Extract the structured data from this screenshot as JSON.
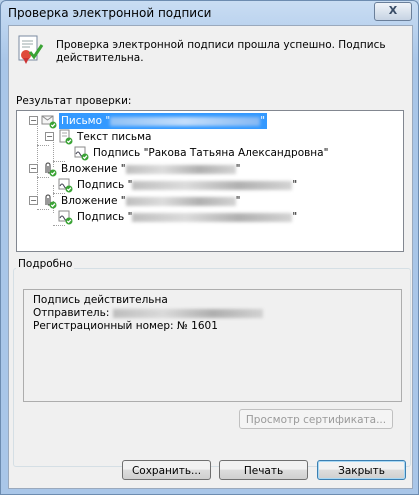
{
  "window": {
    "title": "Проверка электронной подписи",
    "close_label": "X"
  },
  "message": {
    "text": "Проверка электронной подписи прошла успешно. Подпись действительна."
  },
  "result_label": "Результат проверки:",
  "tree": {
    "root": {
      "label": "Письмо \"",
      "label_end": "\"",
      "expander": "−"
    },
    "body": {
      "label": "Текст письма",
      "expander": "−"
    },
    "body_signature": {
      "label": "Подпись \"Ракова Татьяна Александровна\""
    },
    "attachment1": {
      "label": "Вложение \"",
      "label_end": "\"",
      "expander": "−"
    },
    "attachment1_signature": {
      "label": "Подпись \"",
      "label_end": "\""
    },
    "attachment2": {
      "label": "Вложение \"",
      "label_end": "\"",
      "expander": "−"
    },
    "attachment2_signature": {
      "label": "Подпись \"",
      "label_end": "\""
    }
  },
  "details": {
    "group_label": "Подробно",
    "status": "Подпись действительна",
    "sender_label": "Отправитель: ",
    "registration": "Регистрационный номер: № 1601"
  },
  "buttons": {
    "view_certificate": "Просмотр сертификата...",
    "save": "Сохранить...",
    "print": "Печать",
    "close": "Закрыть"
  },
  "icons": {
    "success": "document-checkmark-icon",
    "envelope": "envelope-signed-icon",
    "text": "text-document-icon",
    "signature": "signature-checkmark-icon",
    "attachment": "paperclip-icon"
  },
  "colors": {
    "selection": "#3399ff",
    "check": "#3aa335",
    "title_bar": "#b9d1ea"
  }
}
